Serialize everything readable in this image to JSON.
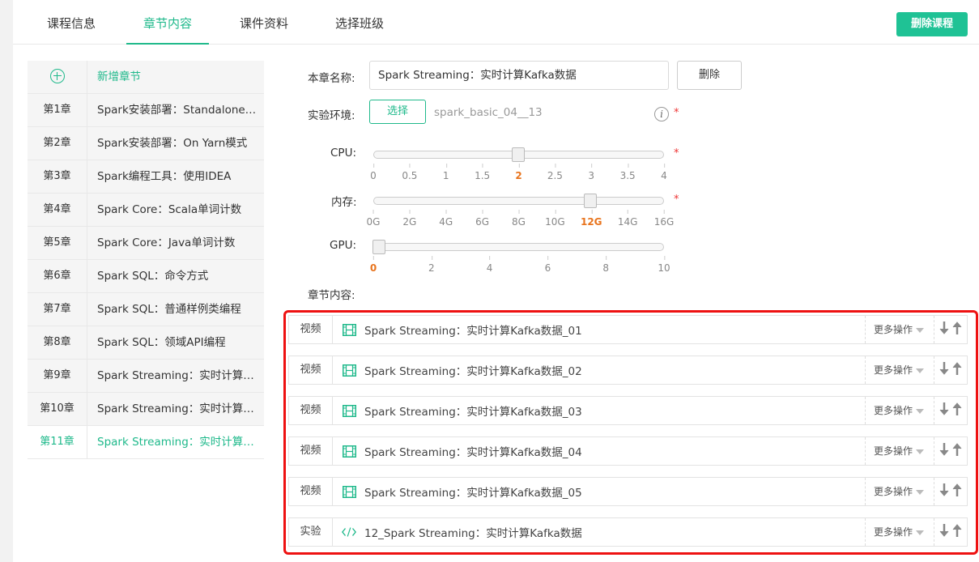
{
  "tabs": [
    "课程信息",
    "章节内容",
    "课件资料",
    "选择班级"
  ],
  "active_tab": "章节内容",
  "header": {
    "delete_course_label": "删除课程"
  },
  "chapters": {
    "add_label": "新增章节",
    "items": [
      {
        "num": "第1章",
        "title": "Spark安装部署：Standalone…"
      },
      {
        "num": "第2章",
        "title": "Spark安装部署：On Yarn模式"
      },
      {
        "num": "第3章",
        "title": "Spark编程工具：使用IDEA"
      },
      {
        "num": "第4章",
        "title": "Spark Core：Scala单词计数"
      },
      {
        "num": "第5章",
        "title": "Spark Core：Java单词计数"
      },
      {
        "num": "第6章",
        "title": "Spark SQL：命令方式"
      },
      {
        "num": "第7章",
        "title": "Spark SQL：普通样例类编程"
      },
      {
        "num": "第8章",
        "title": "Spark SQL：领域API编程"
      },
      {
        "num": "第9章",
        "title": "Spark Streaming：实时计算网…"
      },
      {
        "num": "第10章",
        "title": "Spark Streaming：实时计算H…"
      },
      {
        "num": "第11章",
        "title": "Spark Streaming：实时计算K…"
      }
    ],
    "active_index": 10
  },
  "form": {
    "name_label": "本章名称:",
    "name_value": "Spark Streaming：实时计算Kafka数据",
    "delete_label": "删除",
    "env_label": "实验环境:",
    "select_label": "选择",
    "env_value": "spark_basic_04__13",
    "info_icon": "i",
    "required_mark": "*",
    "content_label": "章节内容:"
  },
  "sliders": {
    "cpu": {
      "label": "CPU:",
      "ticks": [
        "0",
        "0.5",
        "1",
        "1.5",
        "2",
        "2.5",
        "3",
        "3.5",
        "4"
      ],
      "value": "2",
      "fraction": 0.5
    },
    "mem": {
      "label": "内存:",
      "ticks": [
        "0G",
        "2G",
        "4G",
        "6G",
        "8G",
        "10G",
        "12G",
        "14G",
        "16G"
      ],
      "value": "12G",
      "fraction": 0.75
    },
    "gpu": {
      "label": "GPU:",
      "ticks": [
        "0",
        "2",
        "4",
        "6",
        "8",
        "10"
      ],
      "value": "0",
      "fraction": 0
    }
  },
  "content_items": [
    {
      "type": "视频",
      "icon": "film-icon",
      "title": "Spark Streaming：实时计算Kafka数据_01",
      "more": "更多操作"
    },
    {
      "type": "视频",
      "icon": "film-icon",
      "title": "Spark Streaming：实时计算Kafka数据_02",
      "more": "更多操作"
    },
    {
      "type": "视频",
      "icon": "film-icon",
      "title": "Spark Streaming：实时计算Kafka数据_03",
      "more": "更多操作"
    },
    {
      "type": "视频",
      "icon": "film-icon",
      "title": "Spark Streaming：实时计算Kafka数据_04",
      "more": "更多操作"
    },
    {
      "type": "视频",
      "icon": "film-icon",
      "title": "Spark Streaming：实时计算Kafka数据_05",
      "more": "更多操作"
    },
    {
      "type": "实验",
      "icon": "code-icon",
      "title": "12_Spark Streaming：实时计算Kafka数据",
      "more": "更多操作"
    }
  ],
  "colors": {
    "accent": "#1fb98b",
    "highlight_border": "#ee1111",
    "selected_tick": "#e8741d"
  }
}
